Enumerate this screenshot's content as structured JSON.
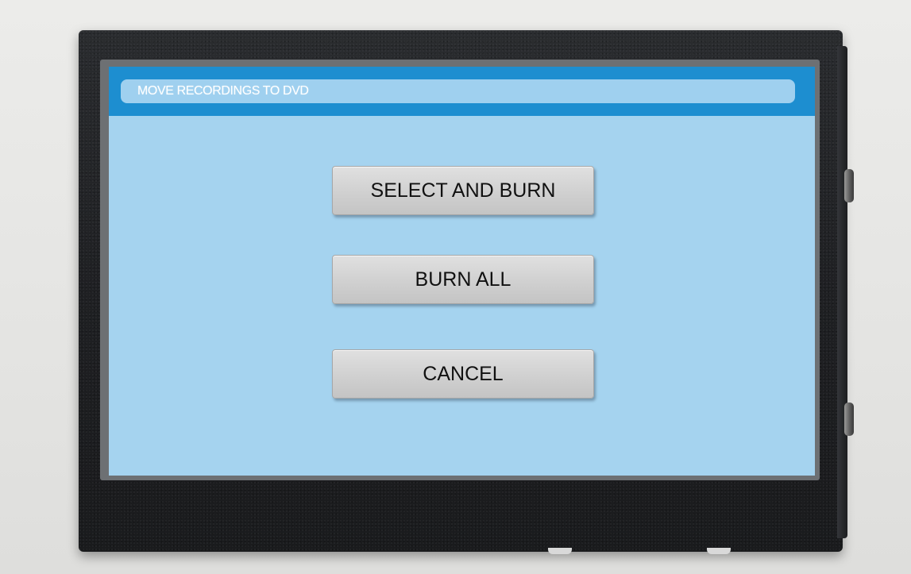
{
  "dialog": {
    "title": "MOVE RECORDINGS TO DVD"
  },
  "buttons": {
    "select_and_burn": "SELECT AND BURN",
    "burn_all": "BURN ALL",
    "cancel": "CANCEL"
  },
  "colors": {
    "screen_background": "#a5d3ef",
    "title_bar": "#1d8ed0",
    "title_pill": "#9fd0ef",
    "button_face": "#d0d0d0",
    "device_body": "#1f2023"
  }
}
